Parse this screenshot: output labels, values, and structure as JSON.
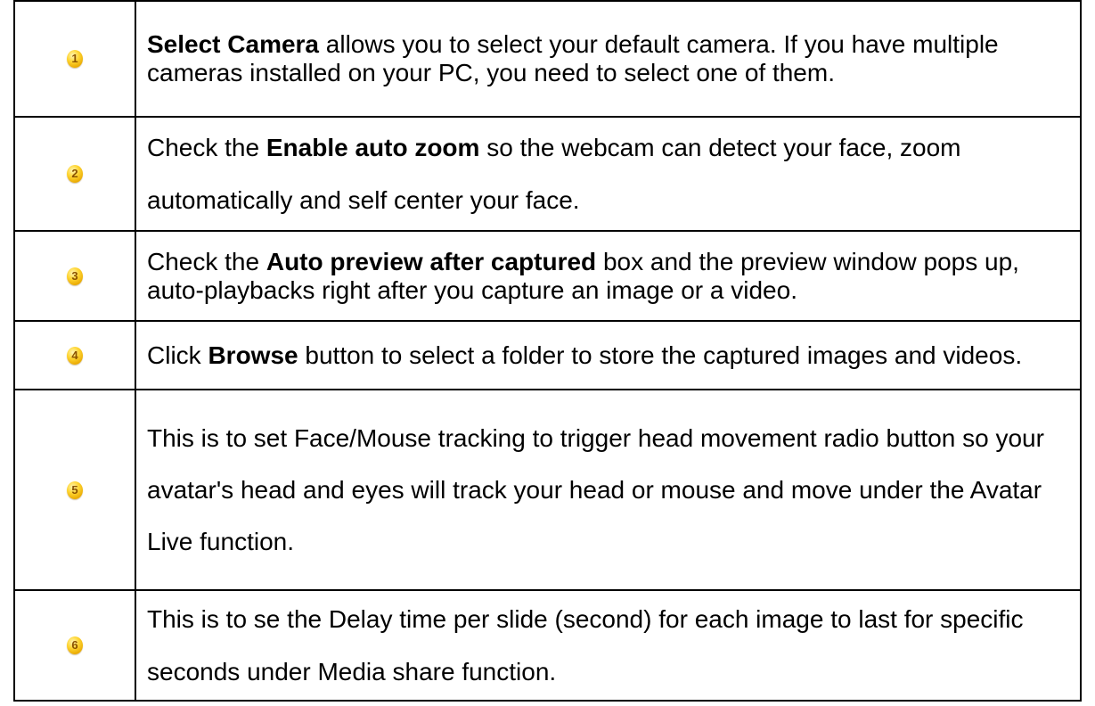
{
  "rows": [
    {
      "number": "1",
      "bold": "Select Camera",
      "text": " allows you to select your default camera. If you have multiple cameras installed on your PC, you need to select one of them."
    },
    {
      "number": "2",
      "prefix": "Check the ",
      "bold": "Enable auto zoom",
      "text": " so the webcam can detect your face, zoom automatically and self center your face."
    },
    {
      "number": "3",
      "prefix": "Check the ",
      "bold": "Auto preview after captured",
      "text": " box and the preview window pops up, auto-playbacks right after you capture an image or a video."
    },
    {
      "number": "4",
      "prefix": "Click ",
      "bold": "Browse",
      "text": " button to select a folder to store the captured images and videos."
    },
    {
      "number": "5",
      "text": "This is to set Face/Mouse tracking to trigger head movement radio button so your avatar's head and eyes will track your head or mouse and move under the Avatar Live function."
    },
    {
      "number": "6",
      "text": "This is to se the Delay time per slide (second) for each image to last for specific seconds under Media share function."
    }
  ],
  "colors": {
    "badge": "#ffd633",
    "badge_text": "#8a5200",
    "border": "#000000"
  },
  "icons": [
    "number-1-badge-icon",
    "number-2-badge-icon",
    "number-3-badge-icon",
    "number-4-badge-icon",
    "number-5-badge-icon",
    "number-6-badge-icon"
  ]
}
